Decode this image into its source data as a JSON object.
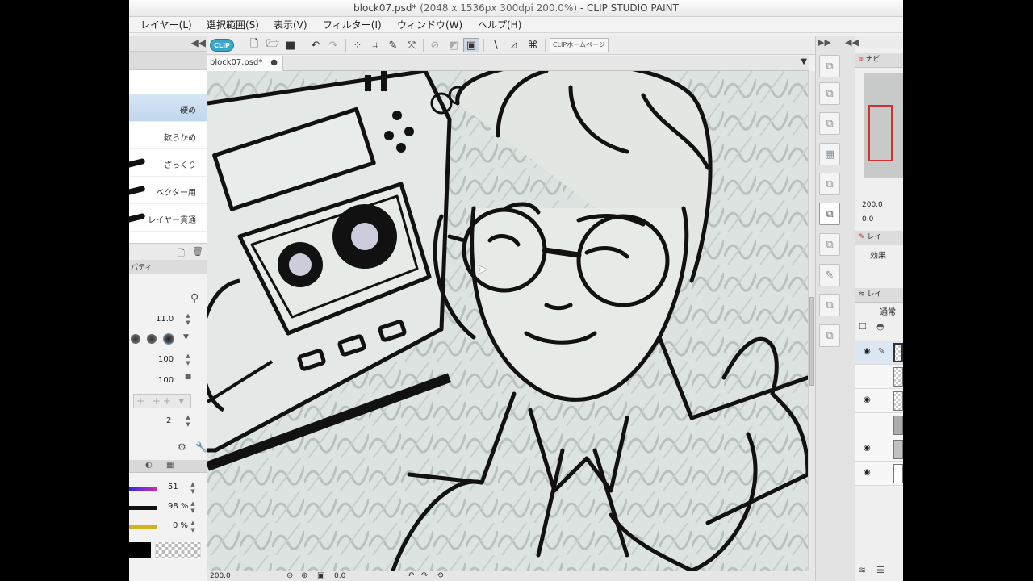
{
  "window": {
    "title_main": "block07.psd*",
    "title_dim": "(2048 x 1536px 300dpi 200.0%)",
    "title_app": "- CLIP STUDIO PAINT"
  },
  "menu": {
    "items": [
      "レイヤー(L)",
      "選択範囲(S)",
      "表示(V)",
      "フィルター(I)",
      "ウィンドウ(W)",
      "ヘルプ(H)"
    ]
  },
  "commandbar": {
    "logo": "CLIP",
    "home_label": "CLIPホームページ"
  },
  "document": {
    "tab_name": "block07.psd*",
    "tab_close": "●"
  },
  "brushes": {
    "items": [
      "硬め",
      "軟らかめ",
      "ざっくり",
      "ベクター用",
      "レイヤー貫通"
    ],
    "selected_index": 0
  },
  "properties": {
    "tab_label": "パティ",
    "size_value": "11.0",
    "opacity_value": "100",
    "density_value": "100",
    "stabilization_value": "2"
  },
  "color": {
    "hue_value": "51",
    "saturation_value": "98 %",
    "brightness_value": "0 %",
    "hue_color": "#d62aa8",
    "yellow_color": "#d4b21e"
  },
  "status": {
    "zoom_value": "200.0",
    "angle_value": "0.0"
  },
  "navigator": {
    "tab_label": "ナビ",
    "zoom_value": "200.0",
    "rotate_value": "0.0"
  },
  "layer_property": {
    "tab_label": "レイ",
    "effect_label": "効果"
  },
  "layers": {
    "tab_label": "レイ",
    "blend_mode": "通常"
  },
  "icons": {
    "undo": "↶",
    "redo": "↷",
    "eye": "◉",
    "search": "⚲"
  }
}
